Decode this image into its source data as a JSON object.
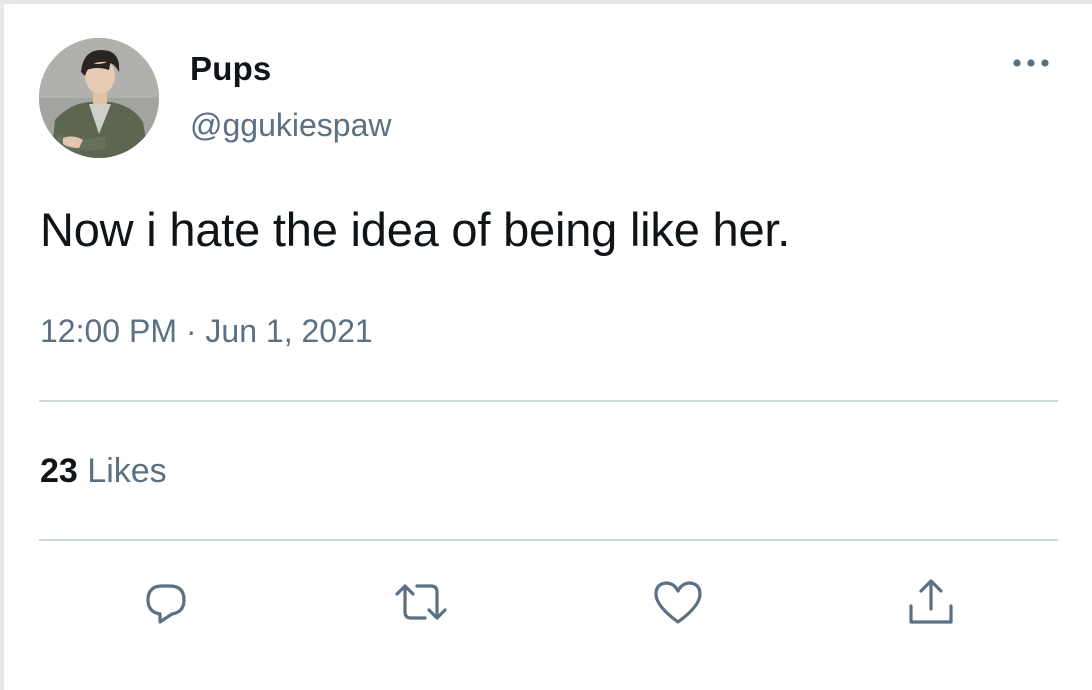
{
  "tweet": {
    "author": {
      "display_name": "Pups",
      "handle": "@ggukiespaw"
    },
    "text": "Now i hate the idea of being like her.",
    "time": "12:00 PM",
    "separator": "·",
    "date": "Jun 1, 2021",
    "likes": {
      "count": "23",
      "label": "Likes"
    }
  },
  "icons": {
    "more": "more-horizontal-icon",
    "reply": "reply-icon",
    "retweet": "retweet-icon",
    "like": "heart-icon",
    "share": "share-icon"
  },
  "colors": {
    "text_primary": "#0f1419",
    "text_secondary": "#5b7083",
    "divider": "#cfd9de",
    "icon": "#5b7083"
  }
}
